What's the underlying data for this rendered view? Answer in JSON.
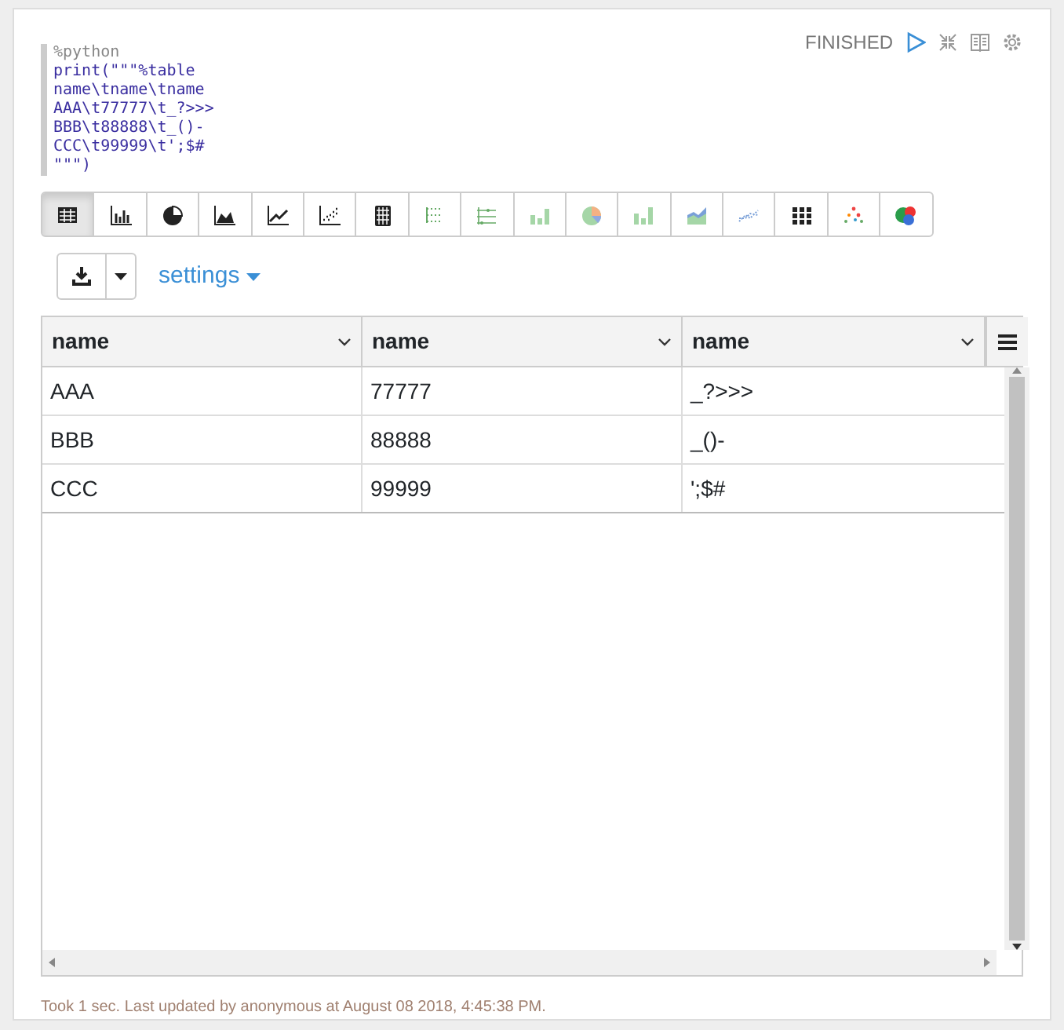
{
  "paragraph": {
    "status": "FINISHED",
    "code": [
      {
        "kind": "directive",
        "text": "%python"
      },
      {
        "kind": "code",
        "text": "print(\"\"\"%table"
      },
      {
        "kind": "code",
        "text": "name\\tname\\tname"
      },
      {
        "kind": "code",
        "text": "AAA\\t77777\\t_?>>>"
      },
      {
        "kind": "code",
        "text": "BBB\\t88888\\t_()-"
      },
      {
        "kind": "code",
        "text": "CCC\\t99999\\t';$#"
      },
      {
        "kind": "code",
        "text": "\"\"\")"
      }
    ],
    "visualizations": [
      {
        "kind": "table",
        "selected": true
      },
      {
        "kind": "bar",
        "selected": false
      },
      {
        "kind": "pie",
        "selected": false
      },
      {
        "kind": "area",
        "selected": false
      },
      {
        "kind": "line",
        "selected": false
      },
      {
        "kind": "scatter",
        "selected": false
      },
      {
        "kind": "grid",
        "selected": false
      },
      {
        "kind": "dotgrid",
        "selected": false
      },
      {
        "kind": "lines",
        "selected": false
      },
      {
        "kind": "greenbar",
        "selected": false
      },
      {
        "kind": "colorpie",
        "selected": false
      },
      {
        "kind": "greenbar2",
        "selected": false
      },
      {
        "kind": "colorarea",
        "selected": false
      },
      {
        "kind": "dottedline",
        "selected": false
      },
      {
        "kind": "dots",
        "selected": false
      },
      {
        "kind": "colorscatter",
        "selected": false
      },
      {
        "kind": "bubbles",
        "selected": false
      }
    ],
    "settings_label": "settings",
    "table": {
      "columns": [
        "name",
        "name",
        "name"
      ],
      "rows": [
        [
          "AAA",
          "77777",
          "_?>>>"
        ],
        [
          "BBB",
          "88888",
          "_()-"
        ],
        [
          "CCC",
          "99999",
          "';$#"
        ]
      ]
    },
    "footer": "Took 1 sec. Last updated by anonymous at August 08 2018, 4:45:38 PM."
  }
}
